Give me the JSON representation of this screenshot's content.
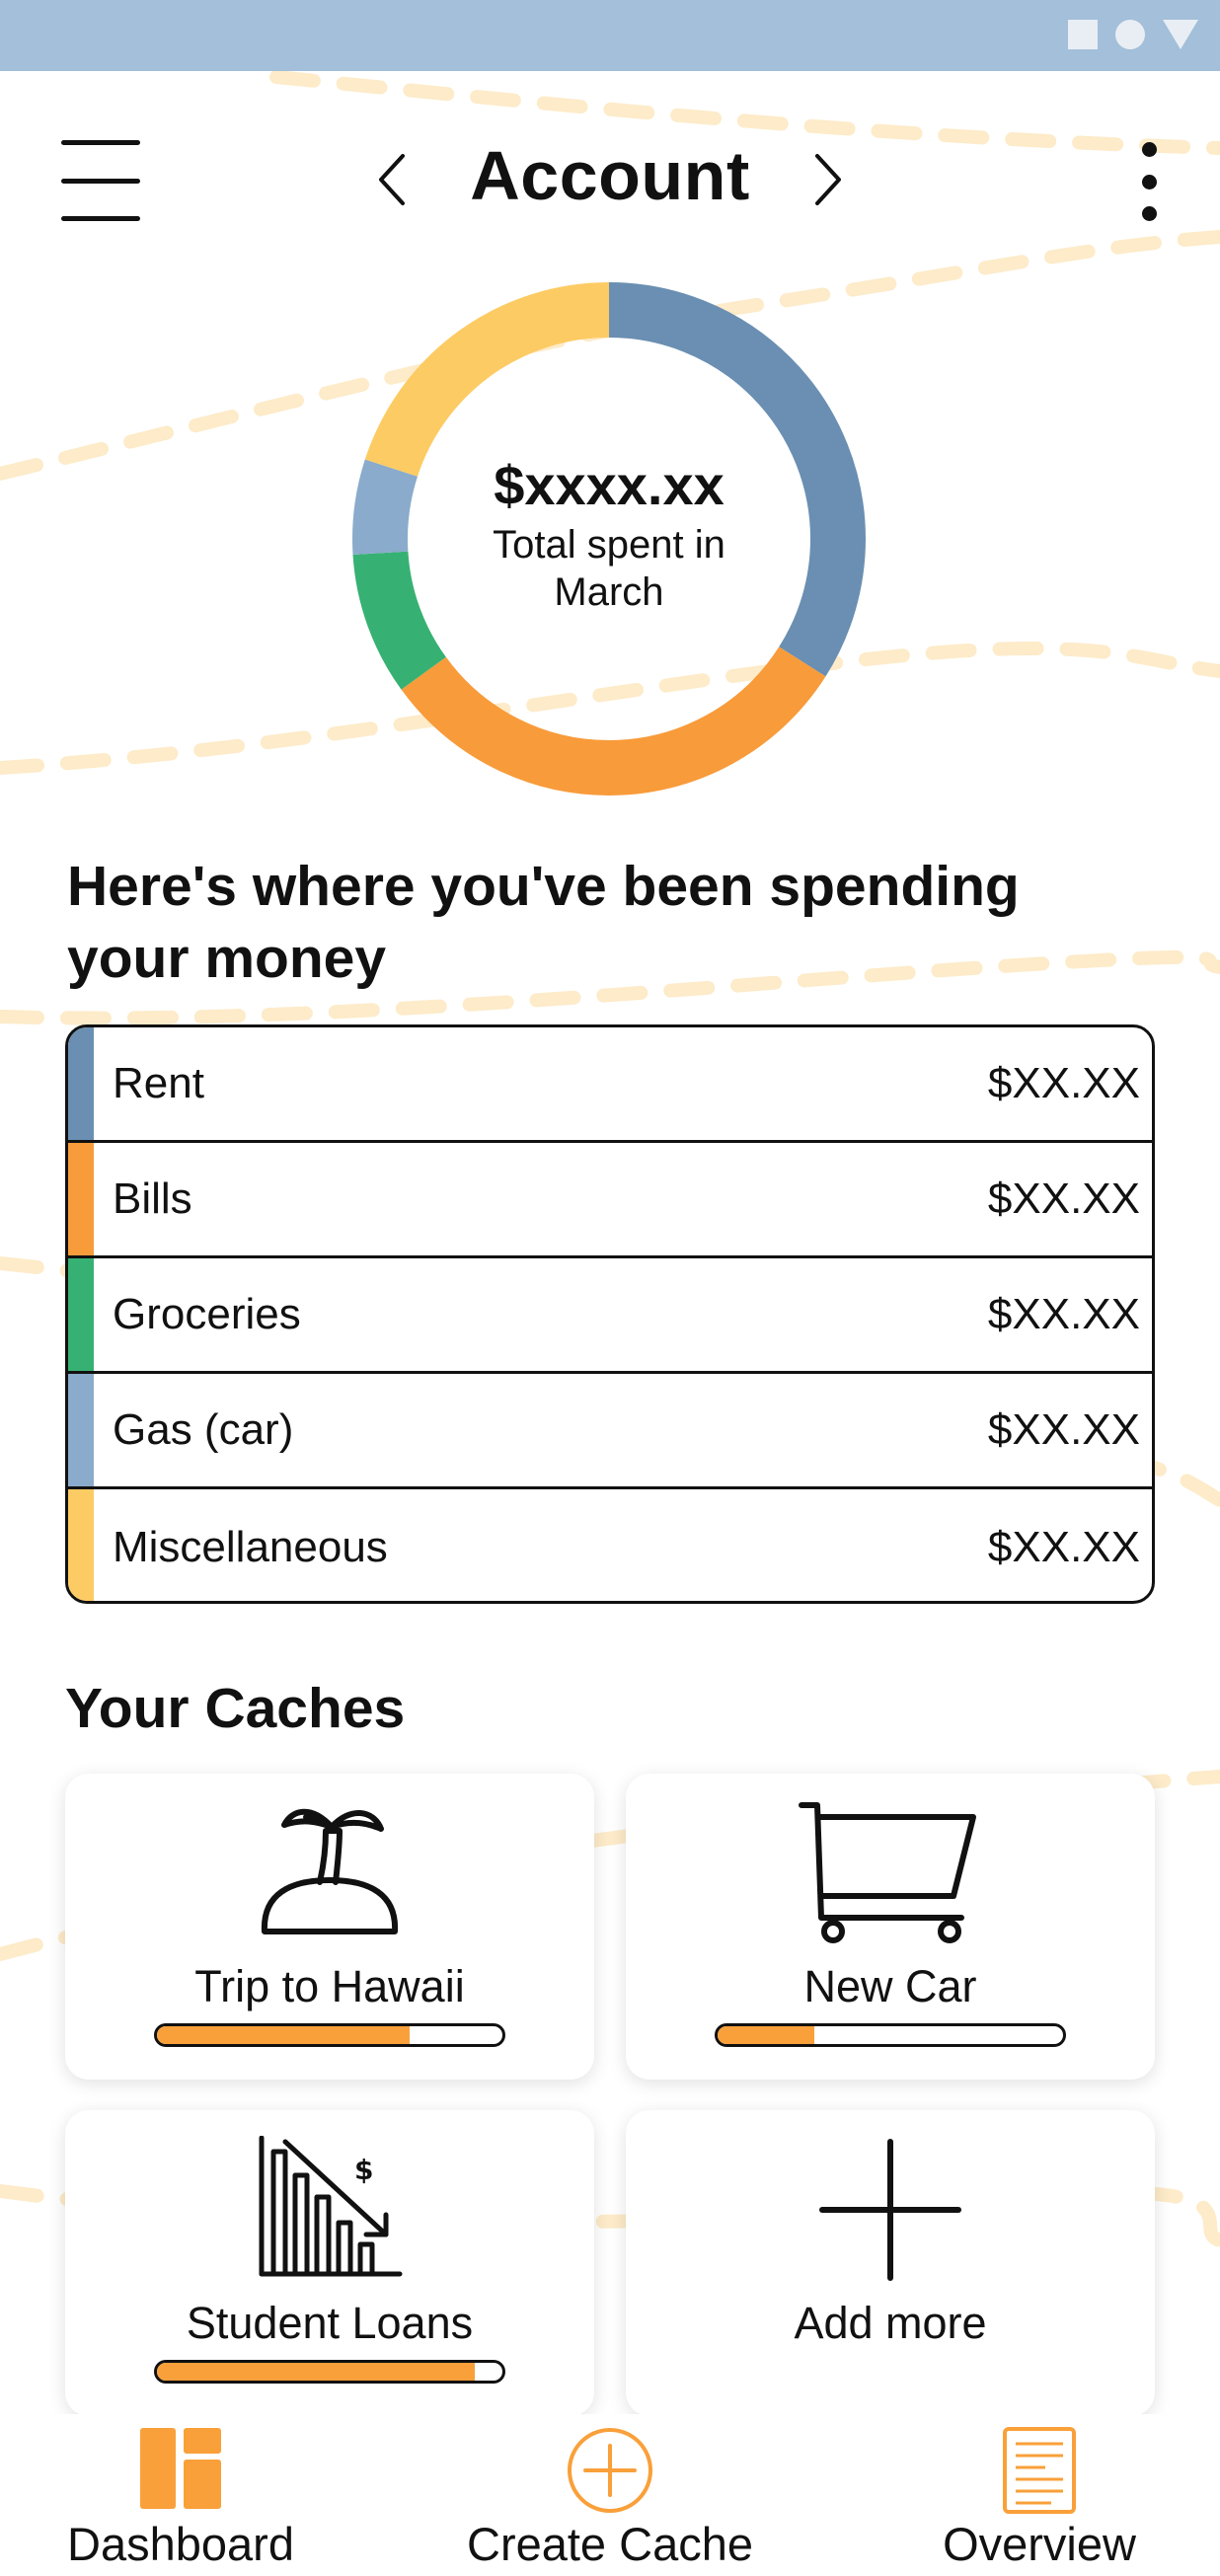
{
  "header": {
    "title": "Account"
  },
  "summary": {
    "total_amount": "$xxxx.xx",
    "total_label": "Total spent in March"
  },
  "spending": {
    "heading": "Here's where you've been spending your money",
    "categories": [
      {
        "label": "Rent",
        "amount": "$XX.XX",
        "color": "#6a8fb2"
      },
      {
        "label": "Bills",
        "amount": "$XX.XX",
        "color": "#f89b3a"
      },
      {
        "label": "Groceries",
        "amount": "$XX.XX",
        "color": "#37b173"
      },
      {
        "label": "Gas (car)",
        "amount": "$XX.XX",
        "color": "#8aabcb"
      },
      {
        "label": "Miscellaneous",
        "amount": "$XX.XX",
        "color": "#fdcb63"
      }
    ]
  },
  "chart_data": {
    "type": "pie",
    "categories": [
      "Rent",
      "Bills",
      "Groceries",
      "Gas (car)",
      "Miscellaneous"
    ],
    "values": [
      34,
      31,
      9,
      6,
      20
    ],
    "colors": [
      "#6a8fb2",
      "#f89b3a",
      "#37b173",
      "#8aabcb",
      "#fdcb63"
    ],
    "title": "",
    "donut": true
  },
  "caches": {
    "heading": "Your Caches",
    "items": [
      {
        "label": "Trip to Hawaii",
        "icon": "island-palm-icon",
        "progress": 0.73
      },
      {
        "label": "New Car",
        "icon": "shopping-cart-icon",
        "progress": 0.28
      },
      {
        "label": "Student Loans",
        "icon": "declining-chart-icon",
        "progress": 0.92
      },
      {
        "label": "Add more",
        "icon": "plus-icon"
      }
    ]
  },
  "nav": {
    "items": [
      {
        "label": "Dashboard",
        "icon": "dashboard-icon"
      },
      {
        "label": "Create Cache",
        "icon": "add-circle-icon"
      },
      {
        "label": "Overview",
        "icon": "document-icon"
      }
    ]
  },
  "colors": {
    "accent": "#f9a03a",
    "status_bar": "#a3bfd9",
    "dash_line": "#fde9c4"
  }
}
